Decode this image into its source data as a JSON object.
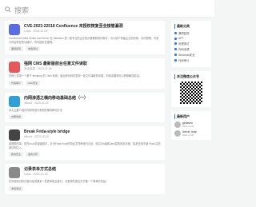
{
  "search": {
    "label": "搜索"
  },
  "posts": [
    {
      "title": "CVE-2023-22518 Confluence 未授权恢复至全接管漏洞",
      "meta": "Lotus · 2023-11-09",
      "excerpt": "Confluence Data Center and Server 在 Atlassian 是一款专业的企业知识管理和协作软件，可以用于构建企业知识库，访问权限，可进行内容恢复的功能时，有可能存在漏洞。",
      "tags": [
        "漏洞复现",
        "渗透测试"
      ],
      "thumb_color": "#5b6ee1"
    },
    {
      "title": "强网 CMS 最新版前台任意文件读取",
      "meta": "安全信息 · 2023-11-06",
      "excerpt": "在网上发现一个基于 thinkphp 的 CMS 系统，最近看代码时发现一处文件读取的问题，利用该漏洞可以获取敏感信息。",
      "tags": [
        "代码审计",
        "Web安全"
      ],
      "thumb_color": "#e45a5a"
    },
    {
      "title": "内网渗透之横向移动基础总结（一）",
      "meta": "xBurst · 2023-11-02",
      "excerpt": "本文主要介绍在内网渗透中常用的横向移动方法",
      "tags": [
        "内网渗透"
      ],
      "thumb_color": "#2f9fd6"
    },
    {
      "title": "Break Frida-style bridge",
      "meta": "xBurst · 2023-10-29",
      "excerpt": "原理很简单，是在hook关键函数中，针对Frida Hook的特征字符串进行过滤，绕过JNI级和Java层的检测手段，保护应用不被 Frida 动态调试和注入。",
      "tags": [
        "移动安全",
        "逆向分析"
      ],
      "thumb_color": "#444444"
    },
    {
      "title": "记录表单方式总结",
      "meta": "Lotus · 2023-10-25",
      "excerpt": "在渗透测试的过程中经常遇到一些表单提交接口，对表单的提交方式做一个简单的总结。",
      "tags": [
        "渗透测试"
      ],
      "thumb_color": "#8a8a8a"
    }
  ],
  "sidebar": {
    "categories_title": "最新分类",
    "categories": [
      "漏洞复现",
      "APT",
      "渗透测试",
      "内网渗透",
      "Windows安全",
      "代码审计"
    ],
    "qr_title": "关注微信公众号",
    "users_title": "最新用户",
    "users": [
      {
        "name": "gedaven",
        "sub": "2023-11-09"
      },
      {
        "name": "Article_leap",
        "sub": "2023-11-08"
      }
    ]
  }
}
